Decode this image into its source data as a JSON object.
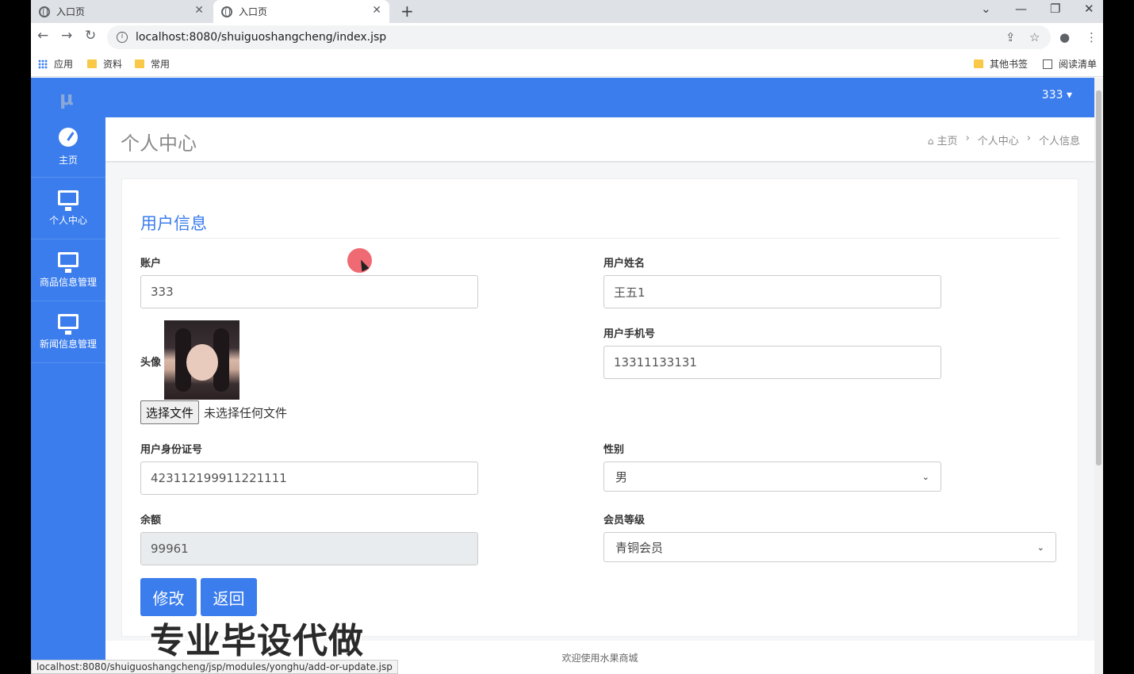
{
  "browser": {
    "tabs": [
      {
        "title": "入口页",
        "active": false
      },
      {
        "title": "入口页",
        "active": true
      }
    ],
    "new_tab": "+",
    "window_controls": [
      "⌄",
      "—",
      "❐",
      "✕"
    ],
    "url": "localhost:8080/shuiguoshangcheng/index.jsp",
    "bookmarks": [
      {
        "label": "应用",
        "icon": "apps-grid-icon"
      },
      {
        "label": "资料",
        "icon": "folder-icon"
      },
      {
        "label": "常用",
        "icon": "folder-icon"
      }
    ],
    "bookmarks_right": [
      {
        "label": "其他书签",
        "icon": "folder-icon"
      },
      {
        "label": "阅读清单",
        "icon": "reading-list-icon"
      }
    ],
    "status_url": "localhost:8080/shuiguoshangcheng/jsp/modules/yonghu/add-or-update.jsp"
  },
  "header": {
    "logo": "μ",
    "user": "333 ▾"
  },
  "sidebar": {
    "items": [
      {
        "label": "主页",
        "icon": "dashboard-icon"
      },
      {
        "label": "个人中心",
        "icon": "monitor-icon"
      },
      {
        "label": "商品信息管理",
        "icon": "monitor-icon"
      },
      {
        "label": "新闻信息管理",
        "icon": "monitor-icon"
      }
    ]
  },
  "page": {
    "title": "个人中心",
    "breadcrumb": [
      "主页",
      "个人中心",
      "个人信息"
    ],
    "breadcrumb_sep": "›"
  },
  "form": {
    "title": "用户信息",
    "account_label": "账户",
    "account_value": "333",
    "name_label": "用户姓名",
    "name_value": "王五1",
    "avatar_label": "头像",
    "phone_label": "用户手机号",
    "phone_value": "13311133131",
    "file_button": "选择文件",
    "file_status": "未选择任何文件",
    "idcard_label": "用户身份证号",
    "idcard_value": "423112199911221111",
    "gender_label": "性别",
    "gender_value": "男",
    "balance_label": "余额",
    "balance_value": "99961",
    "level_label": "会员等级",
    "level_value": "青铜会员",
    "submit": "修改",
    "back": "返回"
  },
  "footer": "欢迎使用水果商城",
  "overlay": {
    "watermark": "专业毕设代做"
  },
  "colors": {
    "primary": "#3b7ded",
    "background": "#f5f6f8"
  }
}
